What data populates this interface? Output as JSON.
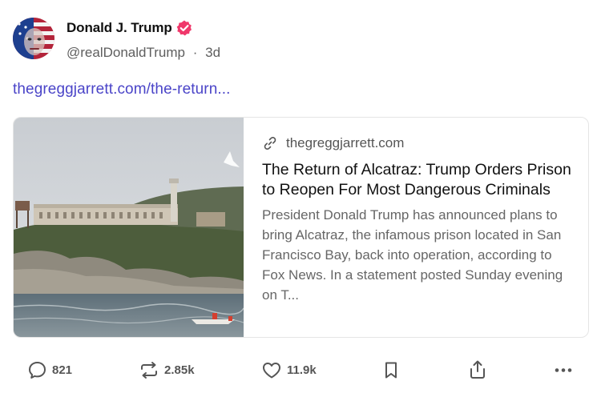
{
  "post": {
    "author_name": "Donald J. Trump",
    "handle": "@realDonaldTrump",
    "separator": "·",
    "timestamp": "3d",
    "link_text": "thegreggjarrett.com/the-return..."
  },
  "card": {
    "source": "thegreggjarrett.com",
    "title": "The Return of Alcatraz: Trump Orders Prison to Reopen For Most Dangerous Criminals",
    "description": "President Donald Trump has announced plans to bring Alcatraz, the infamous prison located in San Francisco Bay, back into operation, according to Fox News. In a statement posted Sunday evening on T..."
  },
  "actions": {
    "reply_count": "821",
    "repost_count": "2.85k",
    "like_count": "11.9k"
  },
  "icons": {
    "verified": "verified-badge-icon",
    "link": "link-icon",
    "reply": "speech-bubble-icon",
    "repost": "repost-arrows-icon",
    "like": "heart-icon",
    "bookmark": "bookmark-icon",
    "share": "share-icon",
    "more": "more-dots-icon"
  },
  "colors": {
    "link": "#4a44c8",
    "verified": "#f0386b",
    "muted": "#5e5e5e"
  }
}
